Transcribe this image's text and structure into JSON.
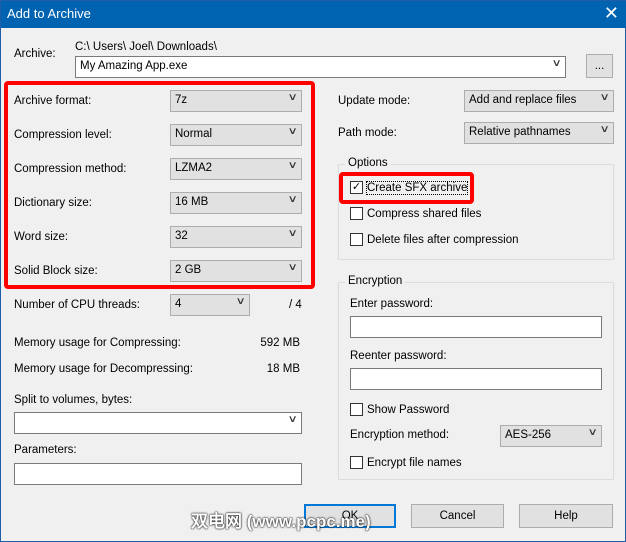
{
  "title": "Add to Archive",
  "archive": {
    "label": "Archive:",
    "path": "C:\\ Users\\ Joel\\ Downloads\\",
    "value": "My Amazing App.exe",
    "browse": "..."
  },
  "left": {
    "rows": [
      {
        "label": "Archive format:",
        "value": "7z"
      },
      {
        "label": "Compression level:",
        "value": "Normal"
      },
      {
        "label": "Compression method:",
        "value": "LZMA2"
      },
      {
        "label": "Dictionary size:",
        "value": "16 MB"
      },
      {
        "label": "Word size:",
        "value": "32"
      },
      {
        "label": "Solid Block size:",
        "value": "2 GB"
      }
    ],
    "cpu": {
      "label": "Number of CPU threads:",
      "value": "4",
      "max": "/ 4"
    },
    "mem_comp": {
      "label": "Memory usage for Compressing:",
      "value": "592 MB"
    },
    "mem_decomp": {
      "label": "Memory usage for Decompressing:",
      "value": "18 MB"
    },
    "split": {
      "label": "Split to volumes, bytes:",
      "value": ""
    },
    "params": {
      "label": "Parameters:",
      "value": ""
    }
  },
  "right": {
    "update": {
      "label": "Update mode:",
      "value": "Add and replace files"
    },
    "path": {
      "label": "Path mode:",
      "value": "Relative pathnames"
    },
    "options": {
      "title": "Options",
      "items": [
        {
          "label": "Create SFX archive",
          "checked": true
        },
        {
          "label": "Compress shared files",
          "checked": false
        },
        {
          "label": "Delete files after compression",
          "checked": false
        }
      ]
    },
    "encryption": {
      "title": "Encryption",
      "enter": "Enter password:",
      "reenter": "Reenter password:",
      "show": "Show Password",
      "method_label": "Encryption method:",
      "method": "AES-256",
      "names": "Encrypt file names"
    }
  },
  "buttons": {
    "ok": "OK",
    "cancel": "Cancel",
    "help": "Help"
  },
  "icons": {
    "close": "✕",
    "chevron": "∨",
    "check": "✓"
  },
  "watermark": "双电网 (www.pcpc.me)"
}
